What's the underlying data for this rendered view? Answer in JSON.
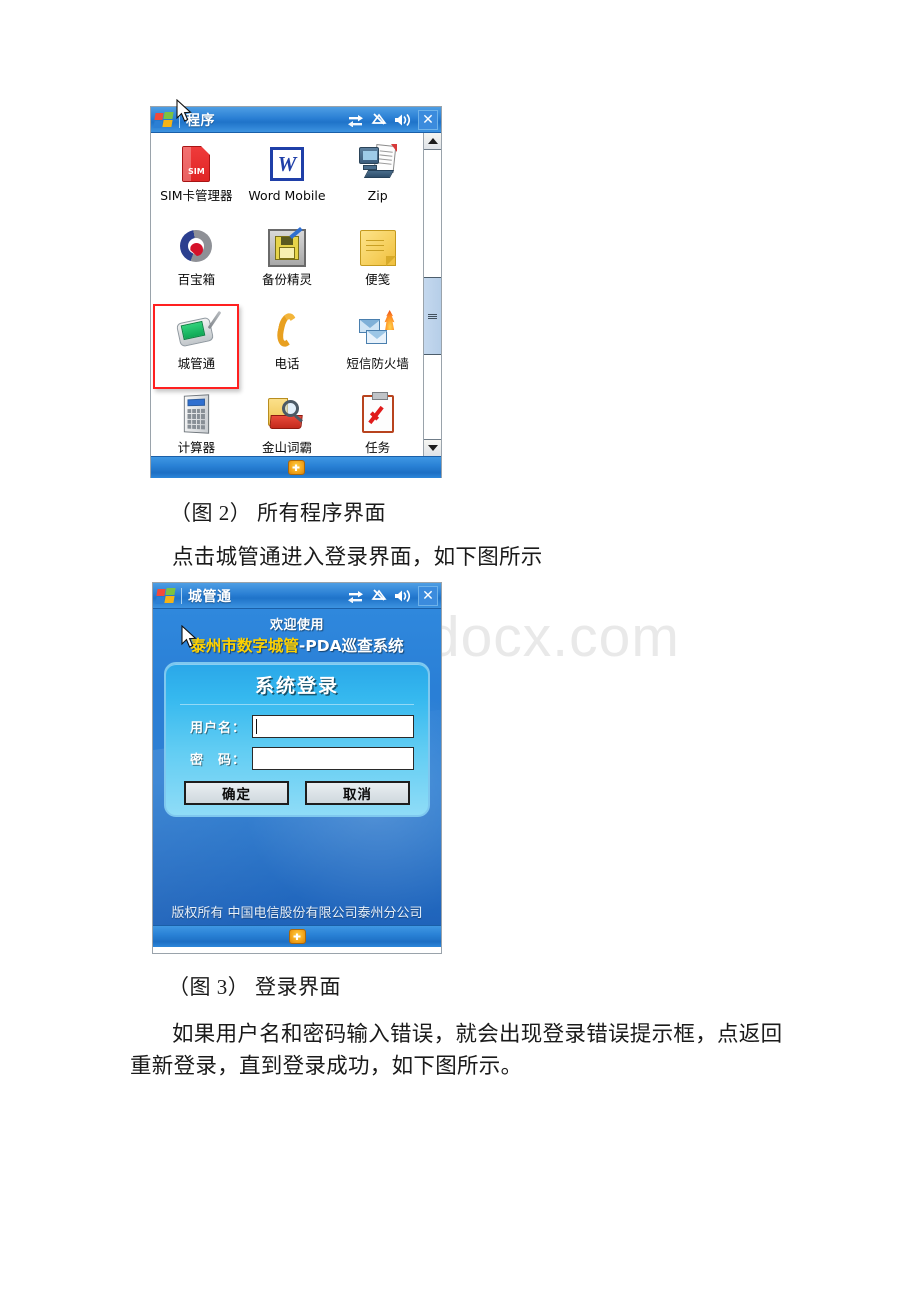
{
  "watermark": "www.bdocx.com",
  "figure1": {
    "window_title": "程序",
    "titlebar_icons": [
      "connectivity-icon",
      "volume-mute-icon",
      "speaker-icon",
      "close-icon"
    ],
    "close_label": "✕",
    "apps": [
      {
        "label": "SIM卡管理器",
        "icon": "sim-card-icon",
        "selected": false
      },
      {
        "label": "Word Mobile",
        "icon": "word-mobile-icon",
        "selected": false
      },
      {
        "label": "Zip",
        "icon": "zip-icon",
        "selected": false
      },
      {
        "label": "百宝箱",
        "icon": "toolbox-icon",
        "selected": false
      },
      {
        "label": "备份精灵",
        "icon": "backup-wizard-icon",
        "selected": false
      },
      {
        "label": "便笺",
        "icon": "notes-icon",
        "selected": false
      },
      {
        "label": "城管通",
        "icon": "chengguantong-icon",
        "selected": true
      },
      {
        "label": "电话",
        "icon": "phone-icon",
        "selected": false
      },
      {
        "label": "短信防火墙",
        "icon": "sms-firewall-icon",
        "selected": false
      },
      {
        "label": "计算器",
        "icon": "calculator-icon",
        "selected": false
      },
      {
        "label": "金山词霸",
        "icon": "dictionary-icon",
        "selected": false
      },
      {
        "label": "任务",
        "icon": "tasks-icon",
        "selected": false
      }
    ],
    "scrollbar": {
      "thumb_top_pct": 44,
      "thumb_height_pct": 27
    },
    "taskbar_icon": "sip-input-panel-icon"
  },
  "caption1": "（图 2） 所有程序界面",
  "paragraph1": "点击城管通进入登录界面，如下图所示",
  "figure2": {
    "window_title": "城管通",
    "close_label": "✕",
    "welcome": "欢迎使用",
    "system_title_highlight": "泰州市数字城管",
    "system_title_rest": "-PDA巡查系统",
    "panel_heading": "系统登录",
    "username_label": "用户名：",
    "username_value": "",
    "password_label": "密　码：",
    "password_value": "",
    "ok_button": "确定",
    "cancel_button": "取消",
    "copyright": "版权所有 中国电信股份有限公司泰州分公司",
    "taskbar_icon": "sip-input-panel-icon"
  },
  "caption2": "（图 3） 登录界面",
  "paragraph2_line1": "如果用户名和密码输入错误，就会出现登录错误提示框，点返回",
  "paragraph2_line2": "重新登录，直到登录成功，如下图所示。",
  "colors": {
    "titlebar_blue": "#2a7fd4",
    "selection_red": "#ff2020",
    "panel_cyan": "#35b8ef",
    "highlight_yellow": "#ffd200"
  }
}
